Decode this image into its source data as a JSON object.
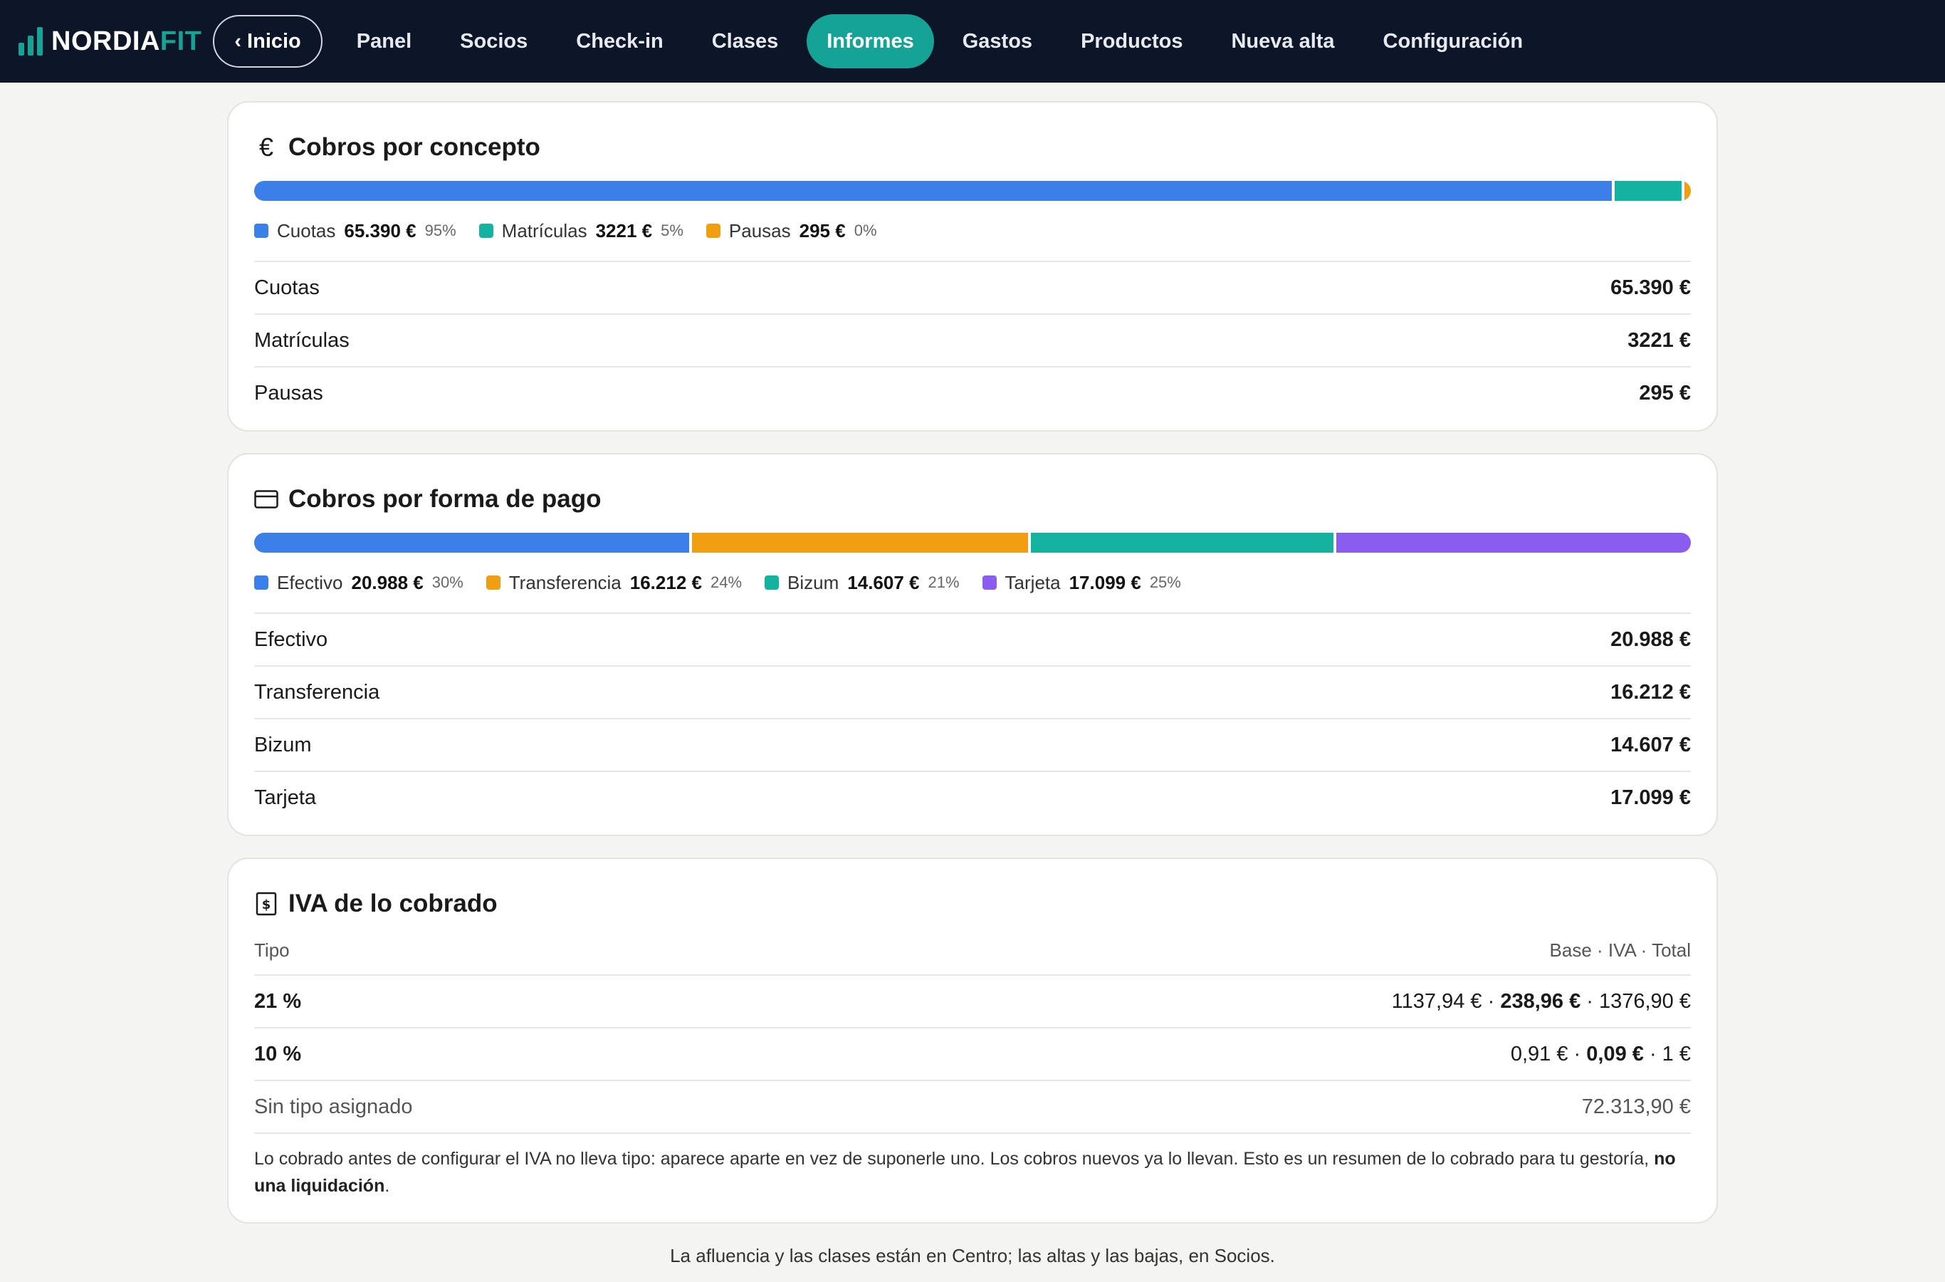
{
  "brand": {
    "part1": "NORDIA",
    "part2": "FIT"
  },
  "nav": {
    "back": "Inicio",
    "items": [
      "Panel",
      "Socios",
      "Check-in",
      "Clases",
      "Informes",
      "Gastos",
      "Productos",
      "Nueva alta",
      "Configuración"
    ],
    "active": "Informes"
  },
  "concepto": {
    "title": "Cobros por concepto",
    "icon": "euro-icon",
    "segments": [
      {
        "name": "Cuotas",
        "amount": "65.390 €",
        "pct": "95%",
        "value": 65390,
        "color": "#3b7fe8"
      },
      {
        "name": "Matrículas",
        "amount": "3221 €",
        "pct": "5%",
        "value": 3221,
        "color": "#14b3a0"
      },
      {
        "name": "Pausas",
        "amount": "295 €",
        "pct": "0%",
        "value": 295,
        "color": "#f09e12"
      }
    ]
  },
  "forma_pago": {
    "title": "Cobros por forma de pago",
    "icon": "card-icon",
    "segments": [
      {
        "name": "Efectivo",
        "amount": "20.988 €",
        "pct": "30%",
        "value": 20988,
        "color": "#3b7fe8"
      },
      {
        "name": "Transferencia",
        "amount": "16.212 €",
        "pct": "24%",
        "value": 16212,
        "color": "#f09e12"
      },
      {
        "name": "Bizum",
        "amount": "14.607 €",
        "pct": "21%",
        "value": 14607,
        "color": "#14b3a0"
      },
      {
        "name": "Tarjeta",
        "amount": "17.099 €",
        "pct": "25%",
        "value": 17099,
        "color": "#8b5cf0"
      }
    ]
  },
  "iva": {
    "title": "IVA de lo cobrado",
    "icon": "receipt-icon",
    "header_left": "Tipo",
    "header_right": "Base · IVA · Total",
    "rows": [
      {
        "tipo": "21 %",
        "base": "1137,94 €",
        "iva": "238,96 €",
        "total": "1376,90 €"
      },
      {
        "tipo": "10 %",
        "base": "0,91 €",
        "iva": "0,09 €",
        "total": "1 €"
      }
    ],
    "sin_tipo_label": "Sin tipo asignado",
    "sin_tipo_value": "72.313,90 €",
    "note_main": "Lo cobrado antes de configurar el IVA no lleva tipo: aparece aparte en vez de suponerle uno. Los cobros nuevos ya lo llevan. Esto es un resumen de lo cobrado para tu gestoría, ",
    "note_bold": "no una liquidación",
    "note_end": "."
  },
  "footer": "La afluencia y las clases están en Centro; las altas y las bajas, en Socios."
}
